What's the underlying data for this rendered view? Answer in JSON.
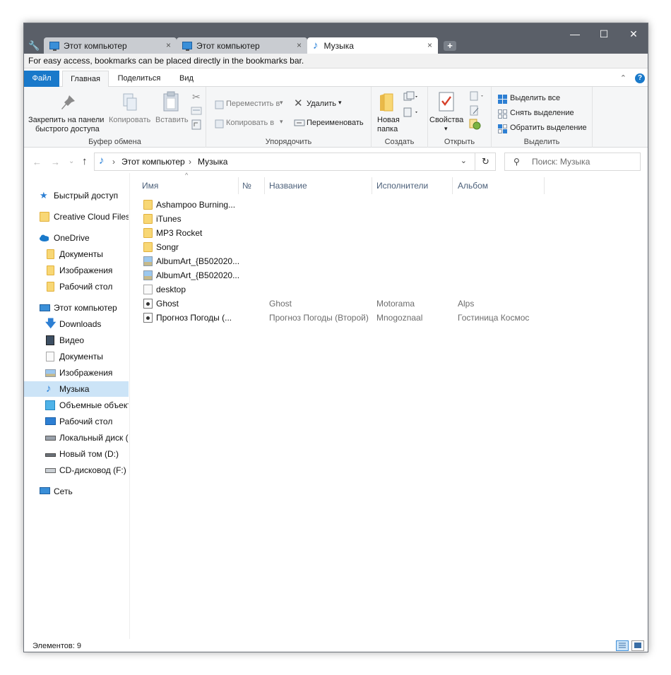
{
  "window": {
    "tabs": [
      {
        "label": "Этот компьютер",
        "icon": "computer-icon"
      },
      {
        "label": "Этот компьютер",
        "icon": "computer-icon"
      },
      {
        "label": "Музыка",
        "icon": "music-note-icon"
      }
    ],
    "tab_close": "×",
    "new_tab": "+",
    "controls": {
      "minimize": "—",
      "maximize": "☐",
      "close": "✕"
    }
  },
  "bookmarks_bar": {
    "text": "For easy access, bookmarks can be placed directly in the bookmarks bar."
  },
  "ribbon_tabs": {
    "file": "Файл",
    "home": "Главная",
    "share": "Поделиться",
    "view": "Вид",
    "collapse": "⌃",
    "help": "?"
  },
  "ribbon": {
    "clipboard": {
      "pin_line1": "Закрепить на панели",
      "pin_line2": "быстрого доступа",
      "copy": "Копировать",
      "paste": "Вставить",
      "label": "Буфер обмена"
    },
    "organize": {
      "move_to": "Переместить в",
      "copy_to": "Копировать в",
      "delete": "Удалить",
      "rename": "Переименовать",
      "label": "Упорядочить"
    },
    "new": {
      "new_folder_line1": "Новая",
      "new_folder_line2": "папка",
      "label": "Создать"
    },
    "open": {
      "properties": "Свойства",
      "label": "Открыть"
    },
    "select": {
      "select_all": "Выделить все",
      "select_none": "Снять выделение",
      "invert": "Обратить выделение",
      "label": "Выделить"
    }
  },
  "navigation": {
    "back": "←",
    "forward": "→",
    "recent": "⌄",
    "up": "↑",
    "breadcrumb": [
      "Этот компьютер",
      "Музыка"
    ],
    "separator": "›",
    "dropdown": "⌄",
    "refresh": "↻",
    "search_placeholder": "Поиск: Музыка"
  },
  "sidebar": {
    "items": [
      {
        "label": "Быстрый доступ",
        "icon": "star-icon"
      },
      {
        "label": "Creative Cloud Files",
        "icon": "creative-cloud-folder-icon"
      },
      {
        "label": "OneDrive",
        "icon": "cloud-icon"
      },
      {
        "label": "Документы",
        "icon": "folder-icon"
      },
      {
        "label": "Изображения",
        "icon": "folder-icon"
      },
      {
        "label": "Рабочий стол",
        "icon": "folder-icon"
      },
      {
        "label": "Этот компьютер",
        "icon": "computer-icon"
      },
      {
        "label": "Downloads",
        "icon": "download-arrow-icon"
      },
      {
        "label": "Видео",
        "icon": "video-icon"
      },
      {
        "label": "Документы",
        "icon": "document-icon"
      },
      {
        "label": "Изображения",
        "icon": "pictures-icon"
      },
      {
        "label": "Музыка",
        "icon": "music-note-icon"
      },
      {
        "label": "Объемные объекты",
        "icon": "3d-objects-icon"
      },
      {
        "label": "Рабочий стол",
        "icon": "desktop-icon"
      },
      {
        "label": "Локальный диск (C:)",
        "icon": "system-drive-icon"
      },
      {
        "label": "Новый том (D:)",
        "icon": "drive-icon"
      },
      {
        "label": "CD-дисковод (F:)",
        "icon": "cd-drive-icon"
      },
      {
        "label": "Сеть",
        "icon": "network-icon"
      }
    ]
  },
  "columns": {
    "name": "Имя",
    "number": "№",
    "title": "Название",
    "artists": "Исполнители",
    "album": "Альбом",
    "sort_caret": "^"
  },
  "files": [
    {
      "name": "Ashampoo Burning...",
      "type": "folder",
      "title": "",
      "artist": "",
      "album": ""
    },
    {
      "name": "iTunes",
      "type": "folder",
      "title": "",
      "artist": "",
      "album": ""
    },
    {
      "name": "MP3 Rocket",
      "type": "folder",
      "title": "",
      "artist": "",
      "album": ""
    },
    {
      "name": "Songr",
      "type": "folder",
      "title": "",
      "artist": "",
      "album": ""
    },
    {
      "name": "AlbumArt_{B502020...",
      "type": "image",
      "title": "",
      "artist": "",
      "album": ""
    },
    {
      "name": "AlbumArt_{B502020...",
      "type": "image",
      "title": "",
      "artist": "",
      "album": ""
    },
    {
      "name": "desktop",
      "type": "document",
      "title": "",
      "artist": "",
      "album": ""
    },
    {
      "name": "Ghost",
      "type": "audio",
      "title": "Ghost",
      "artist": "Motorama",
      "album": "Alps"
    },
    {
      "name": "Прогноз Погоды (...",
      "type": "audio",
      "title": "Прогноз Погоды (Второй)",
      "artist": "Mnogoznaal",
      "album": "Гостиница Космос"
    }
  ],
  "statusbar": {
    "items_count": "Элементов: 9"
  },
  "colors": {
    "accent": "#1979ca",
    "selection": "#cce4f7",
    "titlebar": "#5a5f68"
  }
}
